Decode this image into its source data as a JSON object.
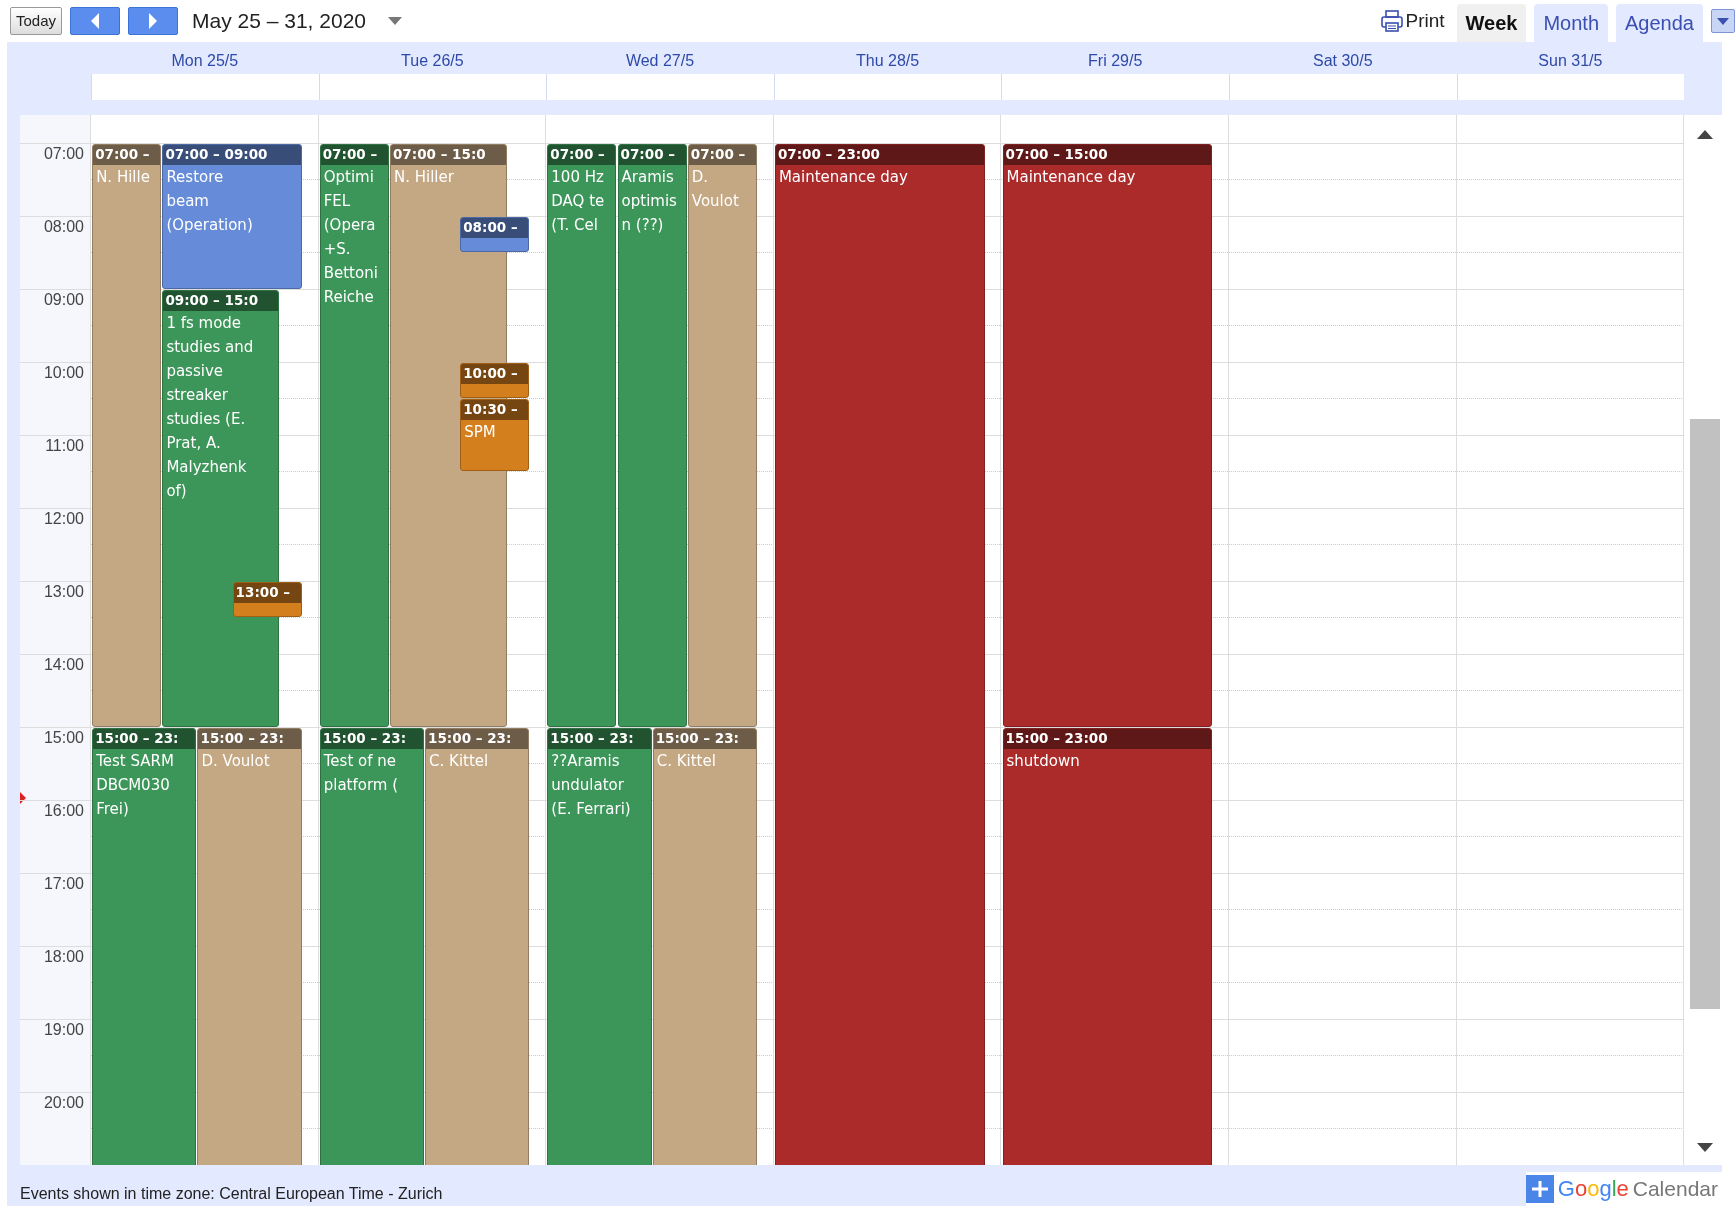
{
  "toolbar": {
    "today_button": "Today",
    "date_range": "May 25 – 31, 2020",
    "print": "Print"
  },
  "view_tabs": [
    {
      "label": "Week",
      "selected": true
    },
    {
      "label": "Month",
      "selected": false
    },
    {
      "label": "Agenda",
      "selected": false
    }
  ],
  "time_labels": [
    "07:00",
    "08:00",
    "09:00",
    "10:00",
    "11:00",
    "12:00",
    "13:00",
    "14:00",
    "15:00",
    "16:00",
    "17:00",
    "18:00",
    "19:00",
    "20:00"
  ],
  "days": [
    {
      "label": "Mon 25/5",
      "events": [
        {
          "kind": "fill",
          "time": "07:00 –",
          "title_lines": [
            "N. Hille"
          ],
          "color": "#c4a783"
        },
        {
          "kind": "timed",
          "time": "07:00 – 09:00",
          "title_lines": [
            "Restore",
            "beam",
            "(Operation)"
          ],
          "color": "#668cd9"
        },
        {
          "kind": "timed",
          "time": "09:00 – 15:0",
          "title_lines": [
            "1 fs mode",
            "studies and",
            "passive",
            "streaker",
            "studies (E.",
            "Prat, A.",
            "Malyzhenk",
            "of)"
          ],
          "color": "#3d9659"
        },
        {
          "kind": "half_hour",
          "time": "13:00 –",
          "color": "#d47f1e"
        },
        {
          "kind": "timed",
          "time": "15:00 – 23:",
          "title_lines": [
            "Test SARM",
            "DBCM030",
            "Frei)"
          ],
          "color": "#3d9659"
        },
        {
          "kind": "timed",
          "time": "15:00 – 23:",
          "title_lines": [
            "D. Voulot"
          ],
          "color": "#c4a783"
        }
      ]
    },
    {
      "label": "Tue 26/5",
      "events": [
        {
          "kind": "fill",
          "time": "07:00 –",
          "title_lines": [
            "Optimi",
            "FEL",
            "(Opera",
            "+S.",
            "Bettoni",
            "Reiche"
          ],
          "color": "#3d9659"
        },
        {
          "kind": "timed",
          "time": "07:00 – 15:0",
          "title_lines": [
            "N. Hiller"
          ],
          "color": "#c4a783"
        },
        {
          "kind": "half_hour",
          "time": "08:00 –",
          "color": "#668cd9"
        },
        {
          "kind": "half_hour",
          "time": "10:00 –",
          "color": "#d47f1e"
        },
        {
          "kind": "hour",
          "time": "10:30 –",
          "title_lines": [
            "SPM"
          ],
          "color": "#d47f1e"
        },
        {
          "kind": "timed",
          "time": "15:00 – 23:",
          "title_lines": [
            "Test of ne",
            "platform ("
          ],
          "color": "#3d9659"
        },
        {
          "kind": "timed",
          "time": "15:00 – 23:",
          "title_lines": [
            "C. Kittel"
          ],
          "color": "#c4a783"
        }
      ]
    },
    {
      "label": "Wed 27/5",
      "events": [
        {
          "kind": "fill",
          "time": "07:00 –",
          "title_lines": [
            "100 Hz",
            "DAQ te",
            "(T. Cel"
          ],
          "color": "#3d9659"
        },
        {
          "kind": "fill",
          "time": "07:00 –",
          "title_lines": [
            "Aramis",
            "optimis",
            "n (??)"
          ],
          "color": "#3d9659"
        },
        {
          "kind": "fill",
          "time": "07:00 –",
          "title_lines": [
            "D.",
            "Voulot"
          ],
          "color": "#c4a783"
        },
        {
          "kind": "timed",
          "time": "15:00 – 23:",
          "title_lines": [
            "??Aramis",
            "undulator",
            "(E. Ferrari)"
          ],
          "color": "#3d9659"
        },
        {
          "kind": "timed",
          "time": "15:00 – 23:",
          "title_lines": [
            "C. Kittel"
          ],
          "color": "#c4a783"
        }
      ]
    },
    {
      "label": "Thu 28/5",
      "events": [
        {
          "kind": "timed",
          "time": "07:00 – 23:00",
          "title_lines": [
            "Maintenance day"
          ],
          "color": "#ab2b2b"
        }
      ]
    },
    {
      "label": "Fri 29/5",
      "events": [
        {
          "kind": "timed",
          "time": "07:00 – 15:00",
          "title_lines": [
            "Maintenance day"
          ],
          "color": "#ab2b2b"
        },
        {
          "kind": "timed",
          "time": "15:00 – 23:00",
          "title_lines": [
            "shutdown"
          ],
          "color": "#ab2b2b"
        }
      ]
    },
    {
      "label": "Sat 30/5"
    },
    {
      "label": "Sun 31/5"
    }
  ],
  "footer": {
    "timezone_note": "Events shown in time zone: Central European Time - Zurich",
    "logo_brand": "Google",
    "logo_product": "Calendar"
  }
}
